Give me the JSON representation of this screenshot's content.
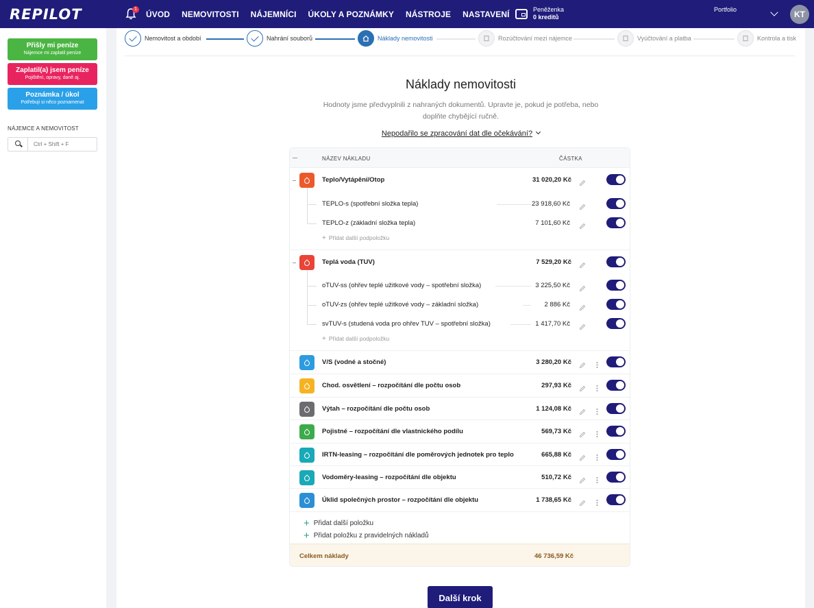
{
  "app": {
    "logo": "REPILOT",
    "notif_count": "1",
    "nav": [
      "ÚVOD",
      "NEMOVITOSTI",
      "NÁJEMNÍCI",
      "ÚKOLY A POZNÁMKY",
      "NÁSTROJE",
      "NASTAVENÍ"
    ],
    "wallet_label": "Peněženka",
    "wallet_value": "0 kreditů",
    "portfolio": "Portfolio",
    "avatar": "KT"
  },
  "sidebar": {
    "buttons": [
      {
        "title": "Přišly mi peníze",
        "sub": "Nájemce mi zaplatil peníze"
      },
      {
        "title": "Zaplatil(a) jsem peníze",
        "sub": "Pojištění, opravy, daně aj."
      },
      {
        "title": "Poznámka / úkol",
        "sub": "Potřebuji si něco poznamenat"
      }
    ],
    "search_label": "NÁJEMCE A NEMOVITOST",
    "search_placeholder": "Ctrl + Shift + F"
  },
  "stepper": [
    {
      "label": "Nemovitost a období",
      "state": "done"
    },
    {
      "label": "Nahrání souborů",
      "state": "done"
    },
    {
      "label": "Náklady nemovitosti",
      "state": "active"
    },
    {
      "label": "Rozúčtování mezi nájemce",
      "state": "todo"
    },
    {
      "label": "Vyúčtování a platba",
      "state": "todo"
    },
    {
      "label": "Kontrola a tisk",
      "state": "todo"
    }
  ],
  "main": {
    "title": "Náklady nemovitosti",
    "desc": "Hodnoty jsme předvyplnili z nahraných dokumentů. Upravte je, pokud je potřeba, nebo doplňte chybějící ručně.",
    "issue_link": "Nepodařilo se zpracování dat dle očekávání?",
    "next_button": "Další krok"
  },
  "table": {
    "col_name": "NÁZEV NÁKLADU",
    "col_amount": "ČÁSTKA",
    "add_sub": "Přidat další podpoložku",
    "groups": [
      {
        "name": "Teplo/Vytápění/Otop",
        "amount": "31 020,20 Kč",
        "color": "#ec5a2b",
        "subs": [
          {
            "name": "TEPLO-s (spotřební složka tepla)",
            "amount": "23 918,60 Kč"
          },
          {
            "name": "TEPLO-z (základní složka tepla)",
            "amount": "7 101,60 Kč"
          }
        ]
      },
      {
        "name": "Teplá voda (TUV)",
        "amount": "7 529,20 Kč",
        "color": "#e94437",
        "subs": [
          {
            "name": "oTUV-ss (ohřev teplé užitkové vody – spotřební složka)",
            "amount": "3 225,50 Kč"
          },
          {
            "name": "oTUV-zs (ohřev teplé užitkové vody – základní složka)",
            "amount": "2 886 Kč"
          },
          {
            "name": "svTUV-s (studená voda pro ohřev TUV – spotřební složka)",
            "amount": "1 417,70 Kč"
          }
        ]
      }
    ],
    "items": [
      {
        "name": "V/S (vodné a stočné)",
        "amount": "3 280,20 Kč",
        "color": "#2d9be0"
      },
      {
        "name": "Chod. osvětlení – rozpočítání dle počtu osob",
        "amount": "297,93 Kč",
        "color": "#f5b324"
      },
      {
        "name": "Výtah – rozpočítání dle počtu osob",
        "amount": "1 124,08 Kč",
        "color": "#6c6c70"
      },
      {
        "name": "Pojistné – rozpočítání dle vlastnického podílu",
        "amount": "569,73 Kč",
        "color": "#3daa4c"
      },
      {
        "name": "IRTN-leasing – rozpočítání dle poměrových jednotek pro teplo",
        "amount": "665,88 Kč",
        "color": "#19a9b7"
      },
      {
        "name": "Vodoměry-leasing – rozpočítání dle objektu",
        "amount": "510,72 Kč",
        "color": "#19a9b7"
      },
      {
        "name": "Úklid společných prostor – rozpočítání dle objektu",
        "amount": "1 738,65 Kč",
        "color": "#2b8fd6"
      }
    ],
    "add_item": "Přidat další položku",
    "add_regular": "Přidat položku z pravidelných nákladů",
    "total_label": "Celkem náklady",
    "total_value": "46 736,59 Kč"
  }
}
